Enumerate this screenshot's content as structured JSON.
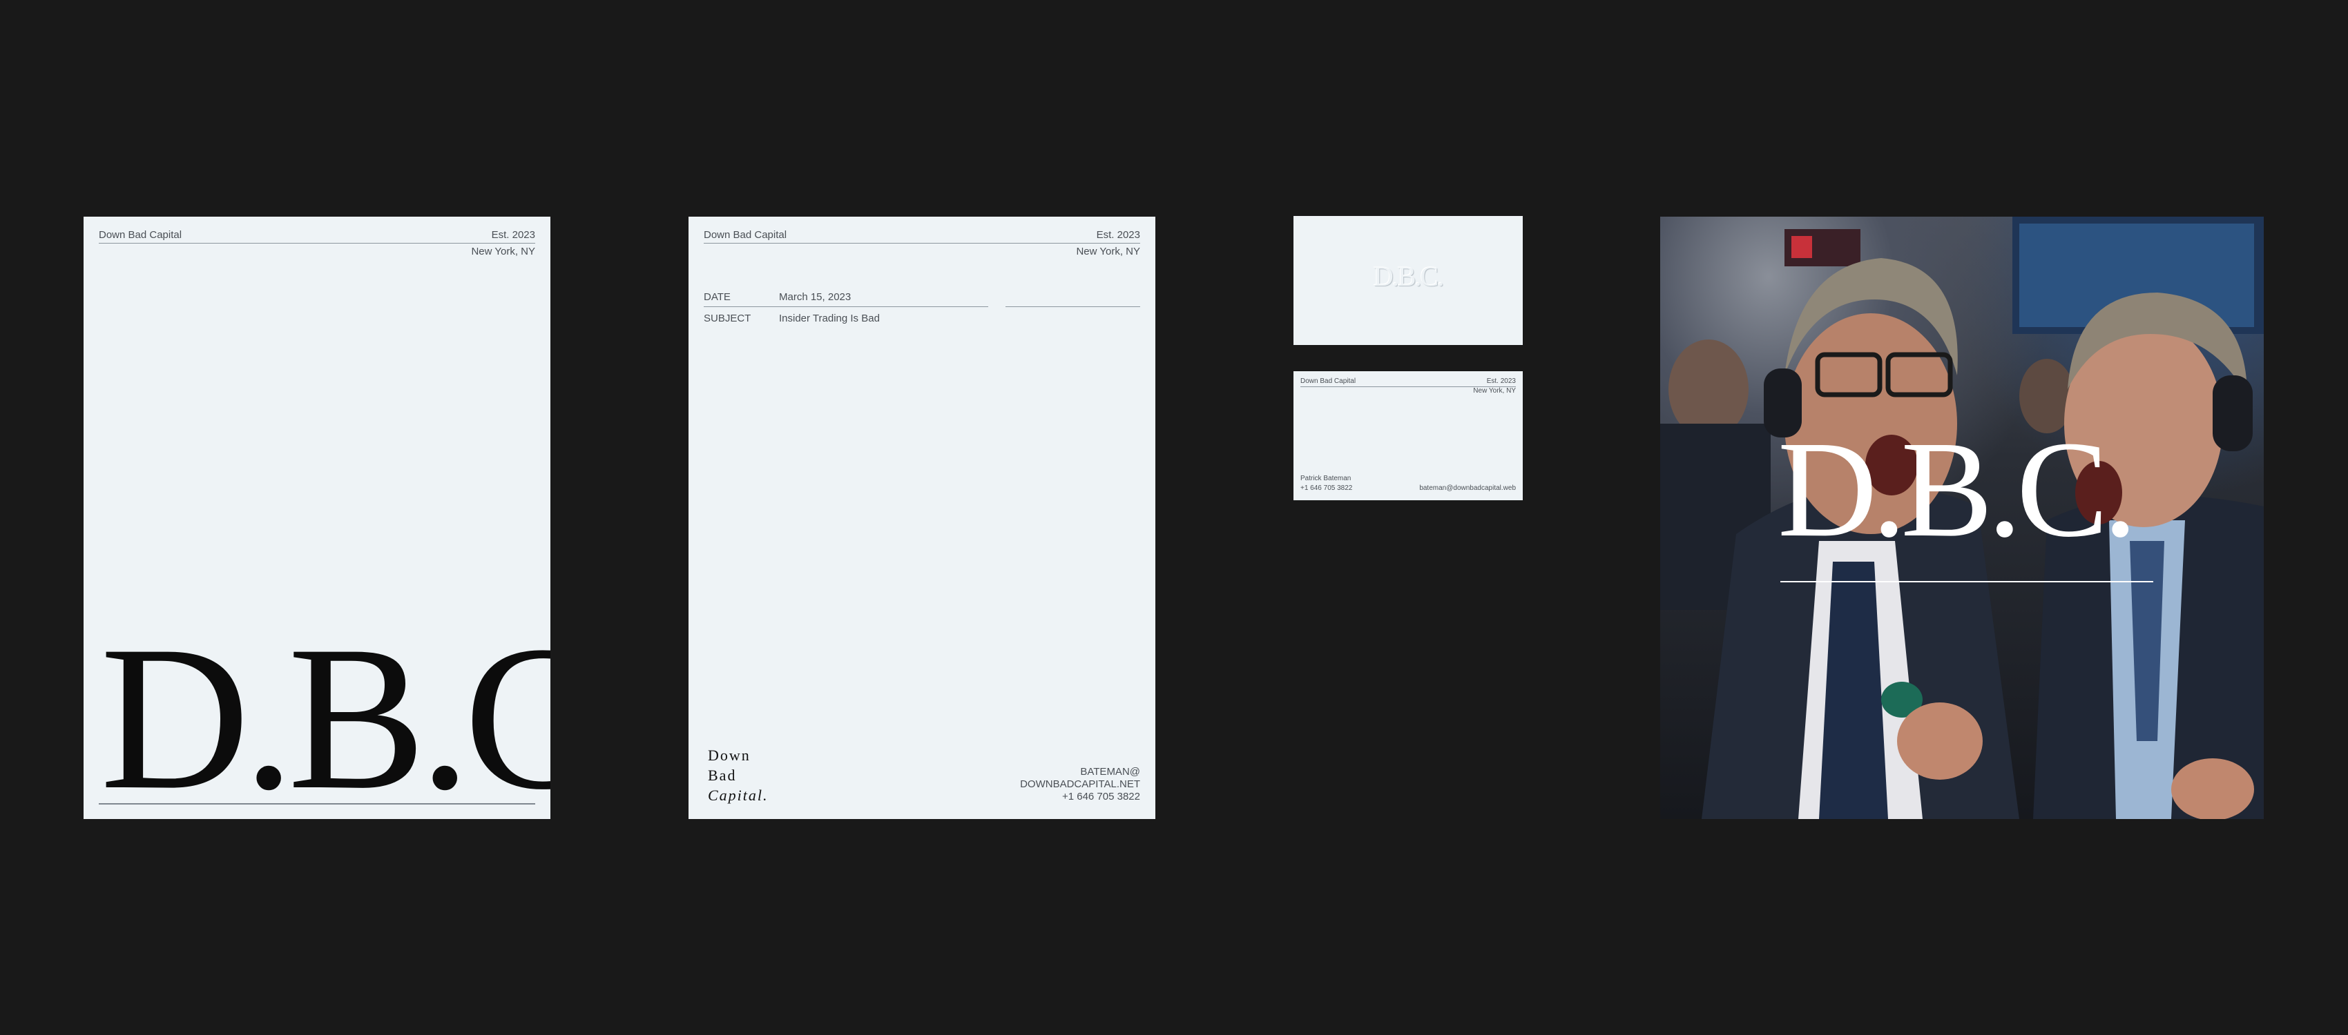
{
  "brand": {
    "name": "Down Bad Capital",
    "established": "Est. 2023",
    "location": "New York, NY",
    "monogram": "D.B.C.",
    "stacked_lines": [
      "Down",
      "Bad",
      "Capital."
    ]
  },
  "letter": {
    "date_label": "DATE",
    "date_value": "March 15, 2023",
    "subject_label": "SUBJECT",
    "subject_value": "Insider Trading Is Bad",
    "contact_lines": [
      "BATEMAN@",
      "DOWNBADCAPITAL.NET",
      "+1 646 705 3822"
    ]
  },
  "business_card": {
    "person_name": "Patrick Bateman",
    "phone": "+1 646 705 3822",
    "email": "bateman@downbadcapital.web"
  },
  "colors": {
    "background": "#191919",
    "paper": "#eef3f6",
    "ink": "#0c0c0c",
    "tie_green": "#1c6b57"
  }
}
